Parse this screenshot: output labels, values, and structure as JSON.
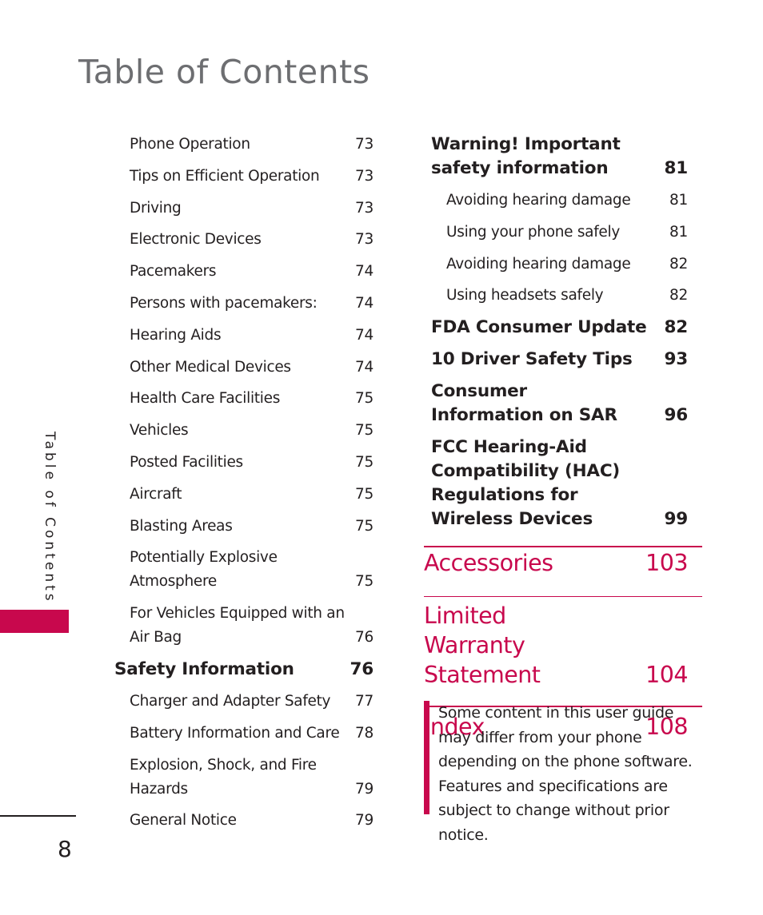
{
  "page": {
    "title": "Table of Contents",
    "side_label": "Table of Contents",
    "page_number": "8",
    "accent_color": "#c8084d"
  },
  "left_column": [
    {
      "label": "Phone Operation",
      "page": "73",
      "level": "sub"
    },
    {
      "label": "Tips on Efficient Operation",
      "page": "73",
      "level": "sub"
    },
    {
      "label": "Driving",
      "page": "73",
      "level": "sub"
    },
    {
      "label": "Electronic Devices",
      "page": "73",
      "level": "sub"
    },
    {
      "label": "Pacemakers",
      "page": "74",
      "level": "sub"
    },
    {
      "label": "Persons with pacemakers:",
      "page": "74",
      "level": "sub"
    },
    {
      "label": "Hearing Aids",
      "page": "74",
      "level": "sub"
    },
    {
      "label": "Other Medical Devices",
      "page": "74",
      "level": "sub"
    },
    {
      "label": "Health Care Facilities",
      "page": "75",
      "level": "sub"
    },
    {
      "label": "Vehicles",
      "page": "75",
      "level": "sub"
    },
    {
      "label": "Posted Facilities",
      "page": "75",
      "level": "sub"
    },
    {
      "label": "Aircraft",
      "page": "75",
      "level": "sub"
    },
    {
      "label": "Blasting Areas",
      "page": "75",
      "level": "sub"
    },
    {
      "label": "Potentially Explosive Atmosphere",
      "page": "75",
      "level": "sub"
    },
    {
      "label": "For Vehicles Equipped with an Air Bag",
      "page": "76",
      "level": "sub"
    },
    {
      "label": "Safety Information",
      "page": "76",
      "level": "main"
    },
    {
      "label": "Charger and Adapter Safety",
      "page": "77",
      "level": "sub"
    },
    {
      "label": "Battery Information and Care",
      "page": "78",
      "level": "sub"
    },
    {
      "label": "Explosion, Shock, and Fire Hazards",
      "page": "79",
      "level": "sub"
    },
    {
      "label": "General Notice",
      "page": "79",
      "level": "sub"
    }
  ],
  "right_column": [
    {
      "label": "Warning! Important safety information",
      "page": "81",
      "level": "main"
    },
    {
      "label": "Avoiding hearing damage",
      "page": "81",
      "level": "sub"
    },
    {
      "label": "Using your phone safely",
      "page": "81",
      "level": "sub"
    },
    {
      "label": "Avoiding hearing damage",
      "page": "82",
      "level": "sub"
    },
    {
      "label": "Using headsets safely",
      "page": "82",
      "level": "sub"
    },
    {
      "label": "FDA Consumer Update",
      "page": "82",
      "level": "main"
    },
    {
      "label": "10 Driver Safety Tips",
      "page": "93",
      "level": "main"
    },
    {
      "label": "Consumer Information on SAR",
      "page": "96",
      "level": "main"
    },
    {
      "label": "FCC Hearing-Aid Compatibility (HAC) Regulations for Wireless Devices",
      "page": "99",
      "level": "main"
    }
  ],
  "chapters": [
    {
      "label": "Accessories",
      "page": "103"
    },
    {
      "label": "Limited Warranty Statement",
      "page": "104"
    },
    {
      "label": "Index",
      "page": "108"
    }
  ],
  "note": "Some content in this user guide may differ from your phone depending on the phone software. Features and specifications are subject to change without prior notice."
}
